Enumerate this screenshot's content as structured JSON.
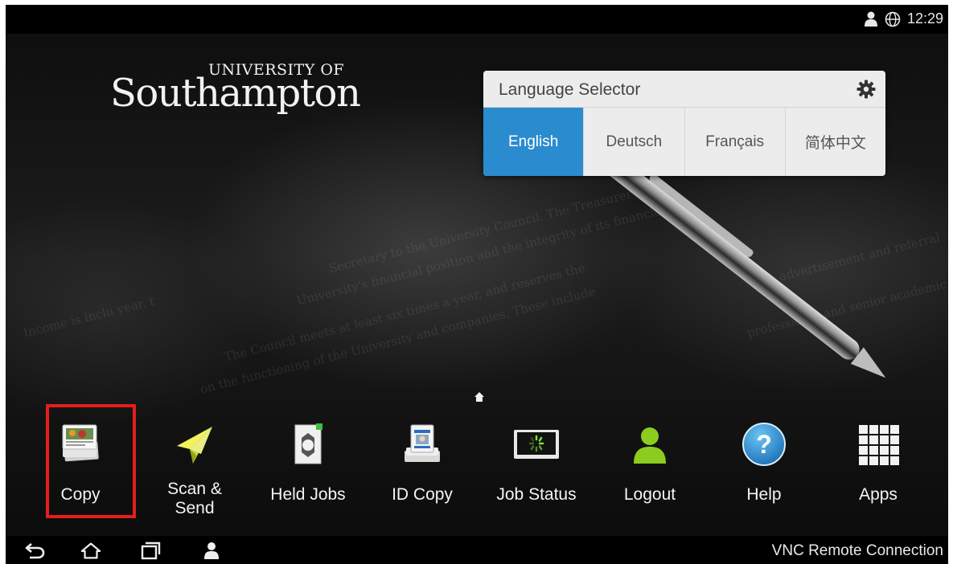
{
  "status_bar": {
    "time": "12:29",
    "icons": [
      "user-icon",
      "globe-icon"
    ]
  },
  "logo": {
    "line1": "UNIVERSITY OF",
    "line2": "Southampton"
  },
  "language_selector": {
    "title": "Language Selector",
    "options": [
      {
        "label": "English",
        "selected": true
      },
      {
        "label": "Deutsch",
        "selected": false
      },
      {
        "label": "Français",
        "selected": false
      },
      {
        "label": "简体中文",
        "selected": false
      }
    ]
  },
  "apps": [
    {
      "label": "Copy",
      "icon": "copy-icon",
      "highlighted": true
    },
    {
      "label_line1": "Scan &",
      "label_line2": "Send",
      "icon": "paper-plane-icon"
    },
    {
      "label": "Held Jobs",
      "icon": "held-jobs-icon"
    },
    {
      "label": "ID Copy",
      "icon": "id-card-icon"
    },
    {
      "label": "Job Status",
      "icon": "job-status-icon"
    },
    {
      "label": "Logout",
      "icon": "user-icon"
    },
    {
      "label": "Help",
      "icon": "help-icon",
      "glyph": "?"
    },
    {
      "label": "Apps",
      "icon": "grid-icon"
    }
  ],
  "nav_bar": {
    "right_text": "VNC Remote Connection"
  },
  "colors": {
    "accent": "#2a8ccf",
    "highlight": "#e51d1d",
    "logout_green": "#8ccc1f",
    "help_blue": "#1b87d0"
  }
}
